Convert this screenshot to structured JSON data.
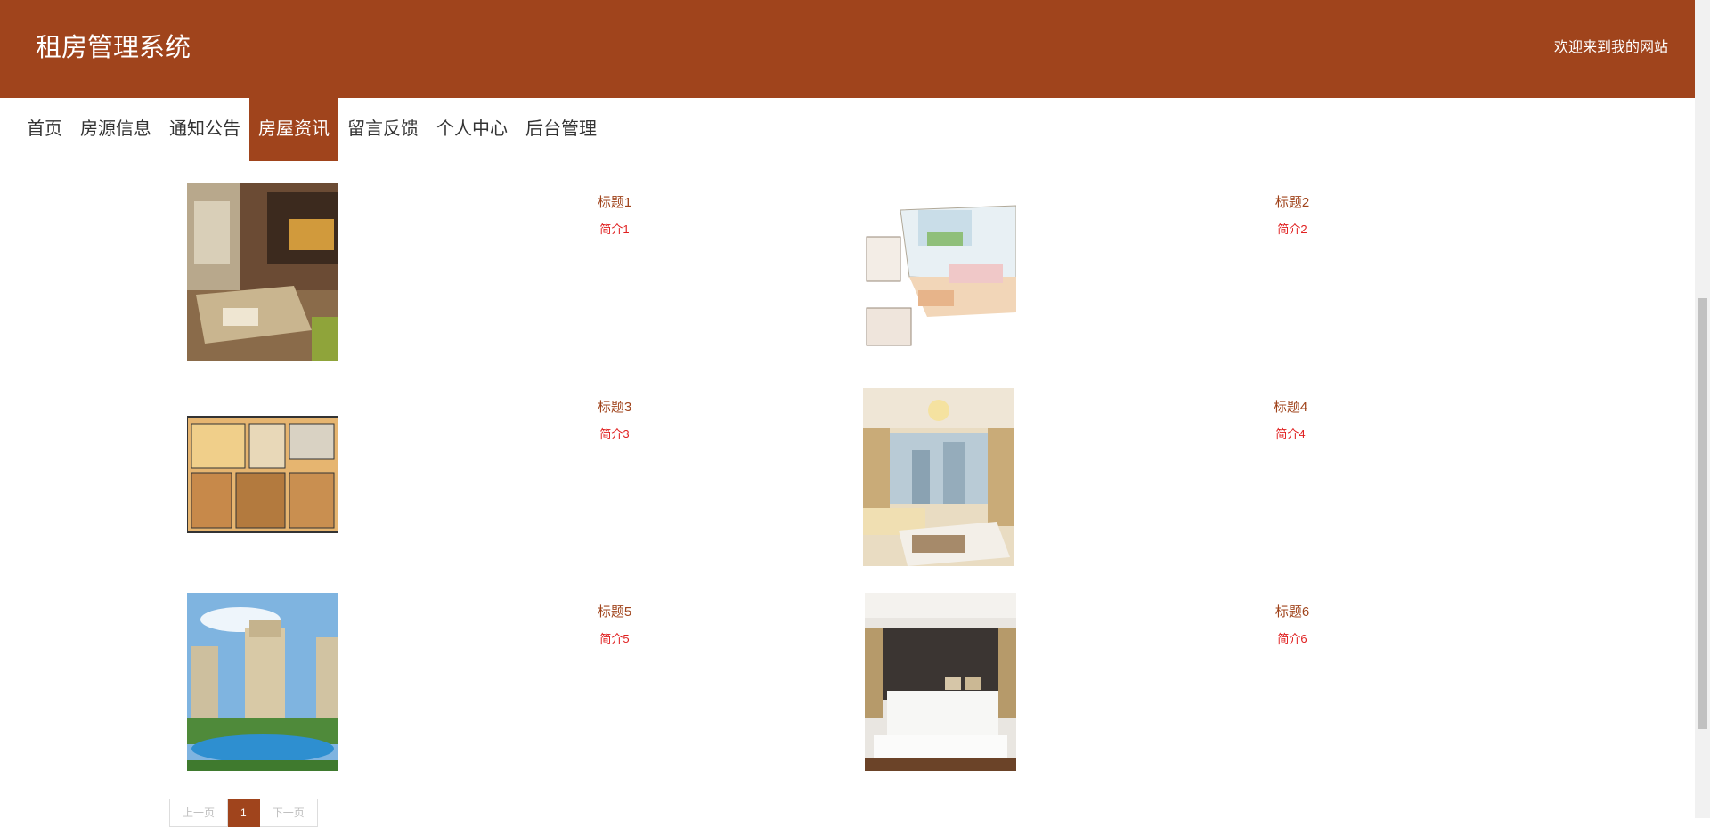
{
  "header": {
    "site_title": "租房管理系统",
    "welcome": "欢迎来到我的网站"
  },
  "nav": [
    {
      "label": "首页"
    },
    {
      "label": "房源信息"
    },
    {
      "label": "通知公告"
    },
    {
      "label": "房屋资讯",
      "active": true
    },
    {
      "label": "留言反馈"
    },
    {
      "label": "个人中心"
    },
    {
      "label": "后台管理"
    }
  ],
  "news": [
    {
      "title": "标题1",
      "intro": "简介1",
      "image": "dining-room-photo"
    },
    {
      "title": "标题2",
      "intro": "简介2",
      "image": "living-room-sketch"
    },
    {
      "title": "标题3",
      "intro": "简介3",
      "image": "floor-plan"
    },
    {
      "title": "标题4",
      "intro": "简介4",
      "image": "living-room-chandelier-photo"
    },
    {
      "title": "标题5",
      "intro": "简介5",
      "image": "apartment-complex-pool-photo"
    },
    {
      "title": "标题6",
      "intro": "简介6",
      "image": "bedroom-photo"
    }
  ],
  "pagination": {
    "prev": "上一页",
    "current": "1",
    "next": "下一页"
  },
  "colors": {
    "brand": "#a0441c",
    "intro_red": "#e02020"
  }
}
